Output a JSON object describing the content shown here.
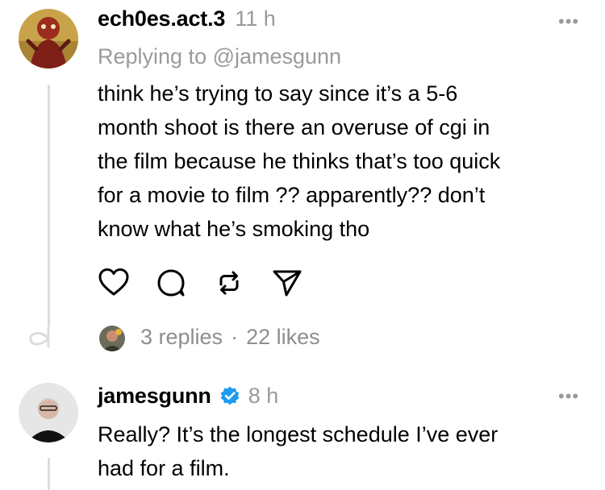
{
  "post1": {
    "username": "ech0es.act.3",
    "time": "11 h",
    "replying_to": "Replying to @jamesgunn",
    "lines": [
      "think he’s trying to say since it’s a 5-6",
      "month shoot is there an overuse of cgi in",
      "the film because he thinks that’s too quick",
      "for a movie to film ?? apparently?? don’t",
      "know what he’s smoking tho"
    ],
    "more_label": "•••",
    "actions": {
      "like_icon": "heart-icon",
      "reply_icon": "comment-icon",
      "repost_icon": "repost-icon",
      "share_icon": "send-icon"
    },
    "replies": "3 replies",
    "separator": "·",
    "likes": "22 likes"
  },
  "post2": {
    "username": "jamesgunn",
    "verified_icon": "verified-badge-icon",
    "time": "8 h",
    "lines": [
      "Really? It’s the longest schedule I’ve ever",
      "had for a film."
    ],
    "more_label": "•••"
  },
  "colors": {
    "verified": "#1d9bf0",
    "muted": "#9a9a9a",
    "thread_line": "#dcdcdc"
  }
}
